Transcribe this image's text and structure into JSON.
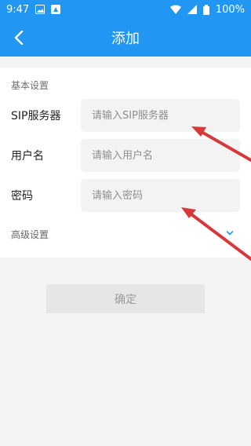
{
  "status_bar": {
    "time": "9:47",
    "battery": "100%",
    "icons": [
      "image-icon",
      "drive-icon",
      "wifi-icon",
      "signal-icon",
      "battery-icon"
    ]
  },
  "app_bar": {
    "title": "添加",
    "back_icon": "back-arrow-icon",
    "color": "#2196f3"
  },
  "form": {
    "section_title": "基本设置",
    "sip_server": {
      "label": "SIP服务器",
      "placeholder": "请输入SIP服务器"
    },
    "username": {
      "label": "用户名",
      "placeholder": "请输入用户名"
    },
    "password": {
      "label": "密码",
      "placeholder": "请输入密码"
    },
    "advanced": {
      "label": "高级设置",
      "icon": "chevron-down-icon"
    }
  },
  "actions": {
    "confirm_label": "确定"
  },
  "annotations": {
    "arrow_color": "#d9383a"
  }
}
